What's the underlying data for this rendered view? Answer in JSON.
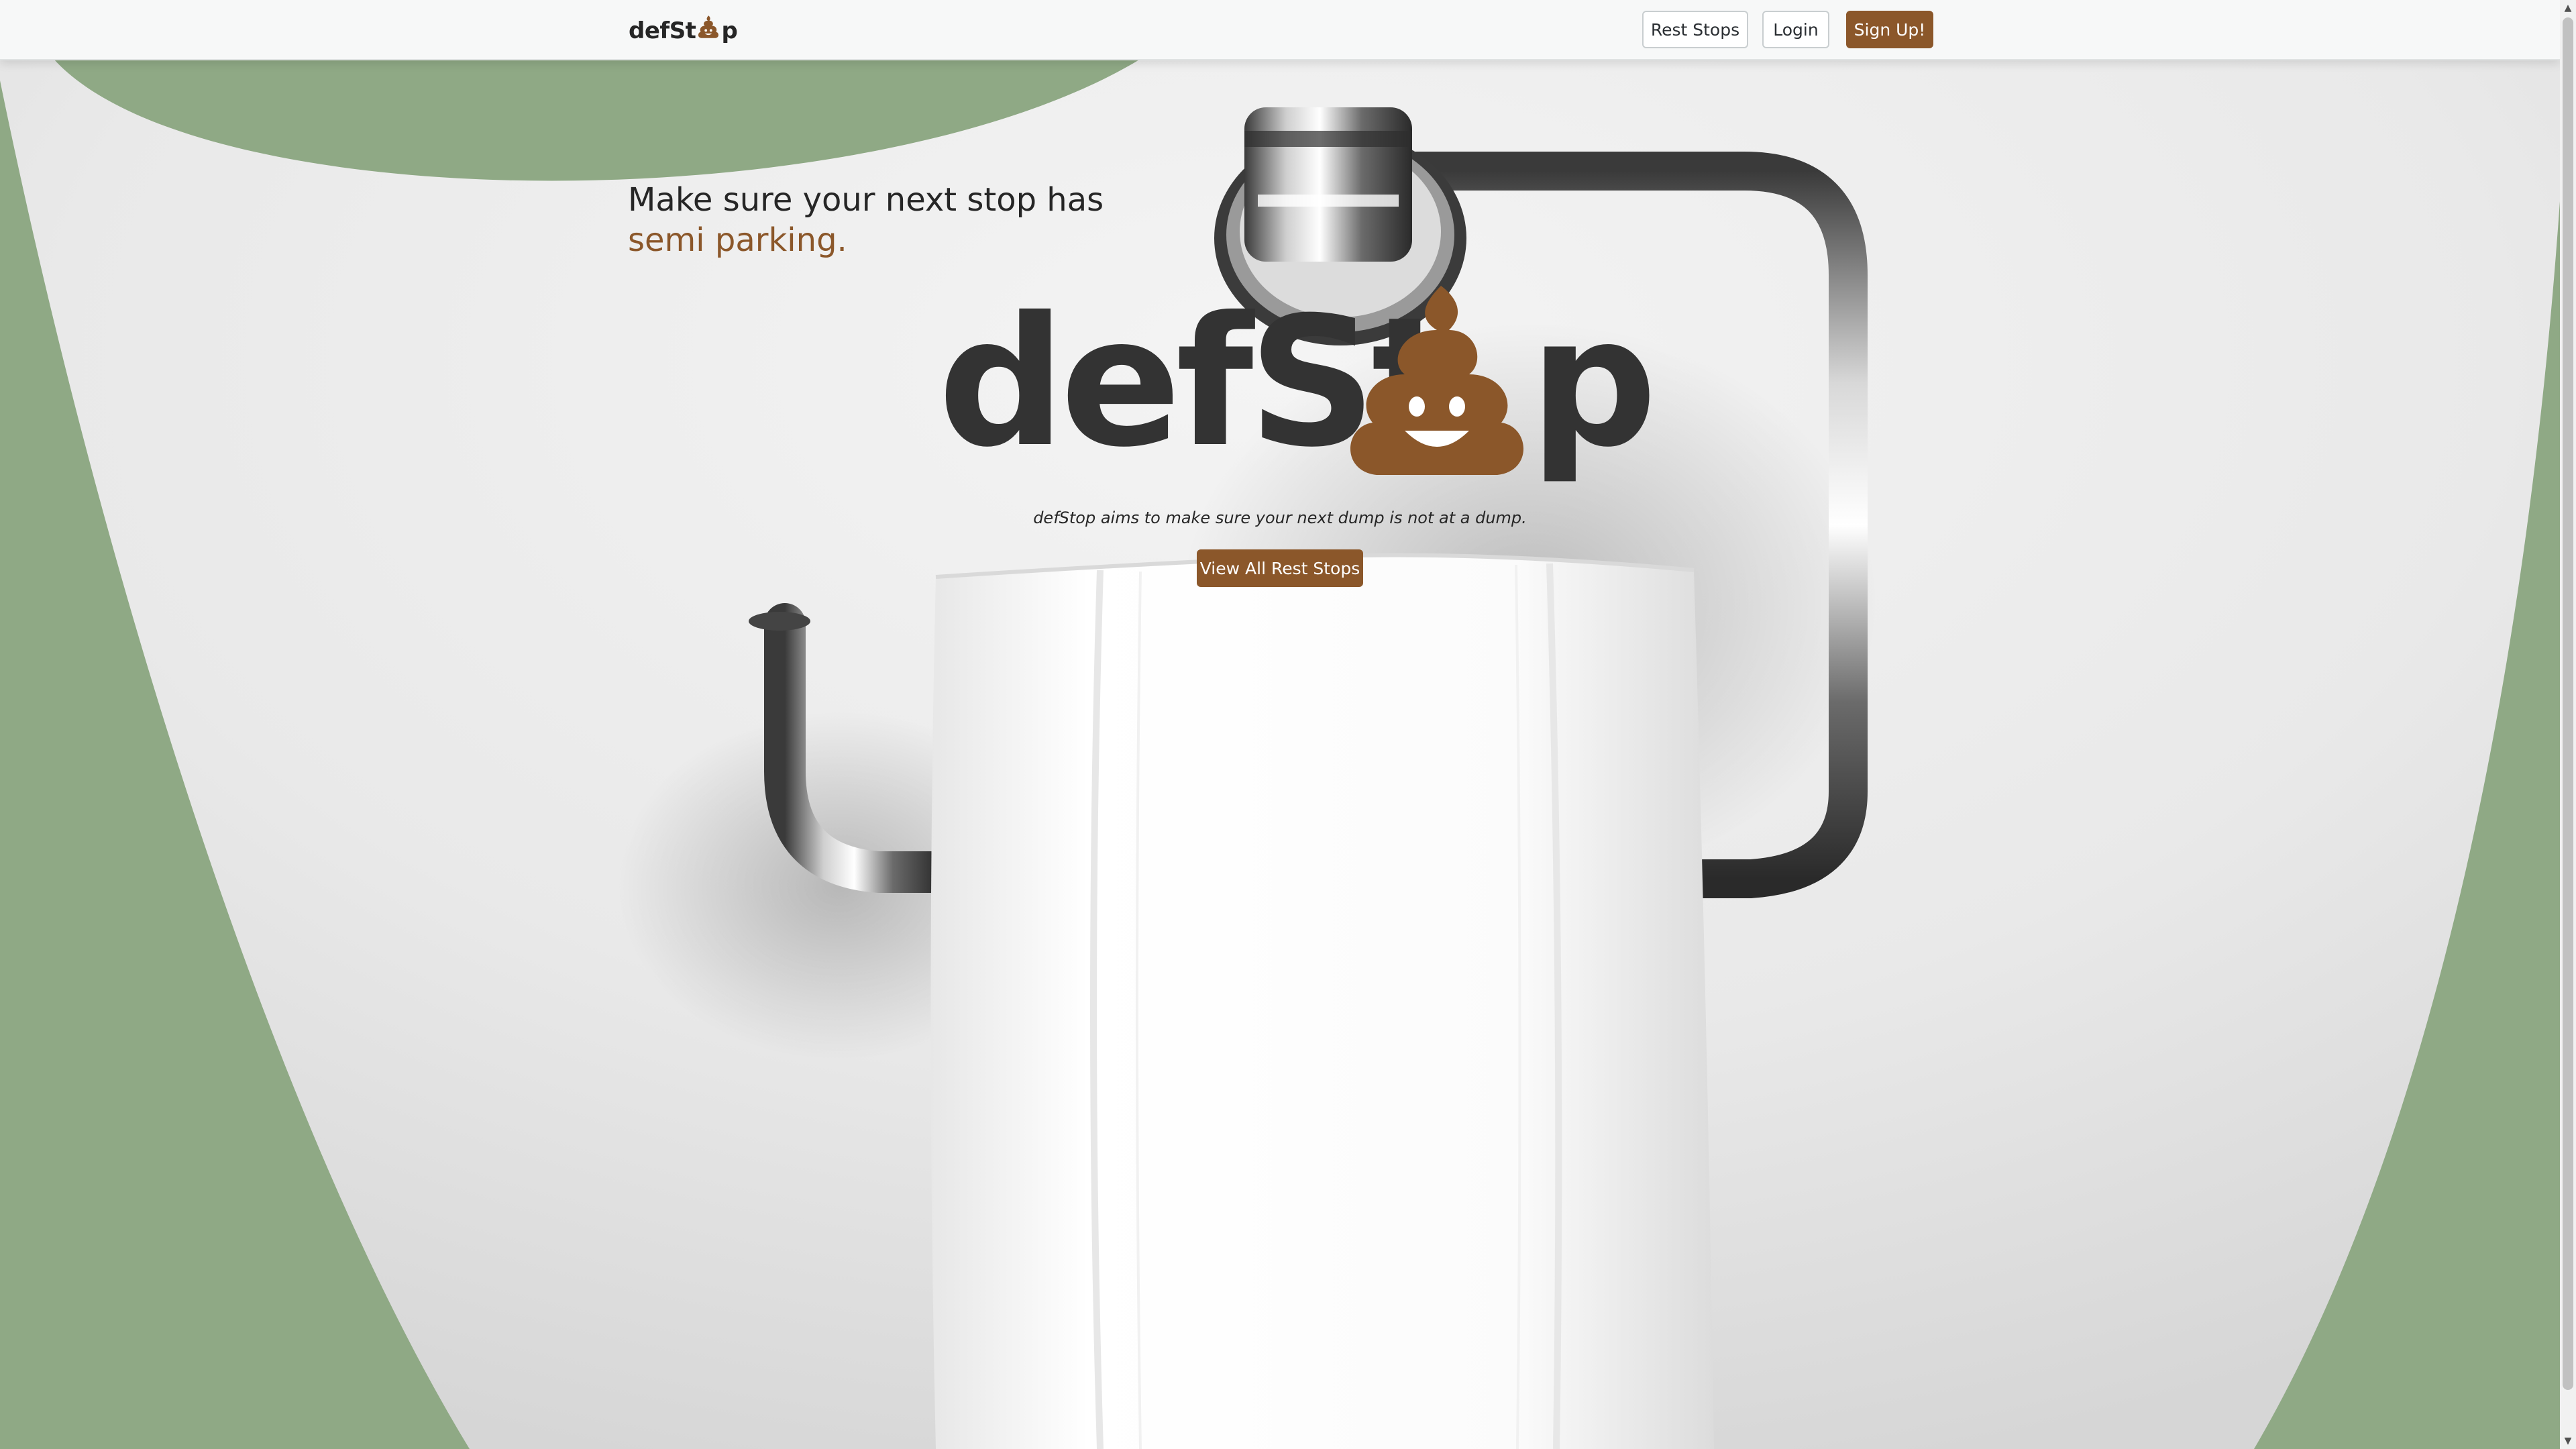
{
  "navbar": {
    "brand_prefix": "defSt",
    "brand_suffix": "p",
    "brand_icon": "poo-icon",
    "rest_stops_label": "Rest Stops",
    "login_label": "Login",
    "signup_label": "Sign Up!"
  },
  "hero": {
    "headline_line1": "Make sure your next stop has",
    "headline_accent": "semi parking.",
    "logo_prefix": "defSt",
    "logo_suffix": "p",
    "logo_icon": "poo-icon",
    "subtitle": "defStop aims to make sure your next dump is not at a dump.",
    "cta_label": "View All Rest Stops",
    "background_image": "toilet-paper-holder-photo"
  },
  "colors": {
    "brand_brown": "#8b572a",
    "sage_green": "#8fa985",
    "text_dark": "#262626",
    "logo_gray": "#333333"
  }
}
